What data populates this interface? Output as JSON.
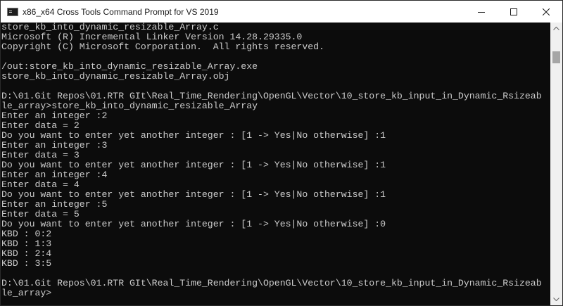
{
  "window": {
    "title": "x86_x64 Cross Tools Command Prompt for VS 2019"
  },
  "console": {
    "lines": [
      "store_kb_into_dynamic_resizable_Array.c",
      "Microsoft (R) Incremental Linker Version 14.28.29335.0",
      "Copyright (C) Microsoft Corporation.  All rights reserved.",
      "",
      "/out:store_kb_into_dynamic_resizable_Array.exe",
      "store_kb_into_dynamic_resizable_Array.obj",
      "",
      "D:\\01.Git Repos\\01.RTR GIt\\Real_Time_Rendering\\OpenGL\\Vector\\10_store_kb_input_in_Dynamic_Rsizeab",
      "le_array>store_kb_into_dynamic_resizable_Array",
      "Enter an integer :2",
      "Enter data = 2",
      "Do you want to enter yet another integer : [1 -> Yes|No otherwise] :1",
      "Enter an integer :3",
      "Enter data = 3",
      "Do you want to enter yet another integer : [1 -> Yes|No otherwise] :1",
      "Enter an integer :4",
      "Enter data = 4",
      "Do you want to enter yet another integer : [1 -> Yes|No otherwise] :1",
      "Enter an integer :5",
      "Enter data = 5",
      "Do you want to enter yet another integer : [1 -> Yes|No otherwise] :0",
      "KBD : 0:2",
      "KBD : 1:3",
      "KBD : 2:4",
      "KBD : 3:5",
      "",
      "D:\\01.Git Repos\\01.RTR GIt\\Real_Time_Rendering\\OpenGL\\Vector\\10_store_kb_input_in_Dynamic_Rsizeab",
      "le_array>"
    ]
  },
  "colors": {
    "console_background": "#0c0c0c",
    "console_text": "#cccccc",
    "titlebar_background": "#ffffff"
  },
  "icons": {
    "app": "console-app-icon",
    "minimize": "minimize-icon",
    "maximize": "maximize-icon",
    "close": "close-icon",
    "scroll_up": "scroll-up-arrow-icon",
    "scroll_down": "scroll-down-arrow-icon"
  }
}
